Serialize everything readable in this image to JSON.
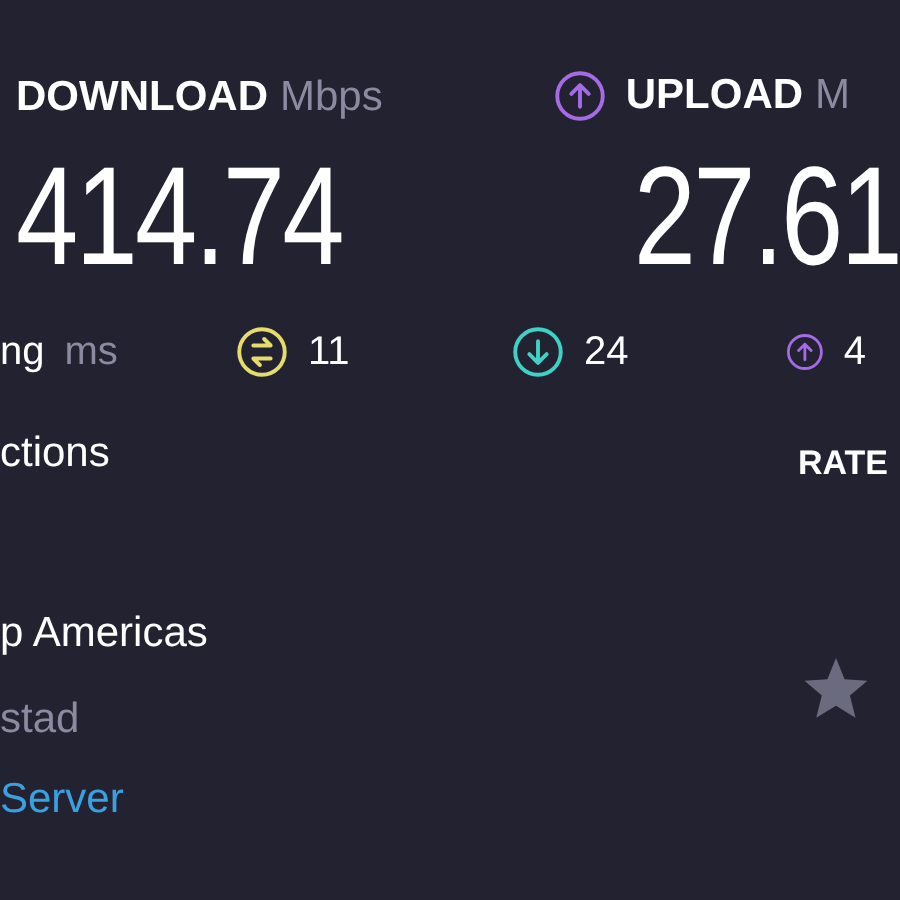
{
  "download": {
    "label": "DOWNLOAD",
    "unit": "Mbps",
    "value": "414.74"
  },
  "upload": {
    "label": "UPLOAD",
    "unit": "M",
    "value": "27.61"
  },
  "ping": {
    "label": "ng",
    "unit": "ms",
    "stats": [
      {
        "kind": "idle",
        "value": "11"
      },
      {
        "kind": "download",
        "value": "24"
      },
      {
        "kind": "upload",
        "value": "4"
      }
    ]
  },
  "connections": {
    "label": "ctions"
  },
  "server": {
    "name": "p Americas",
    "location": "stad",
    "link": "Server"
  },
  "rating": {
    "label": "RATE"
  }
}
